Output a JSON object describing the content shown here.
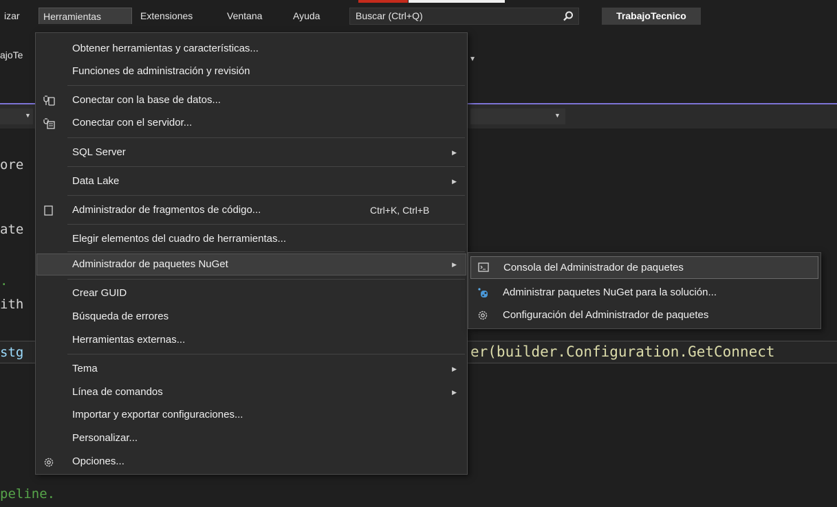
{
  "menubar": {
    "items": [
      {
        "label": "izar",
        "active": false
      },
      {
        "label": "Herramientas",
        "active": true
      },
      {
        "label": "Extensiones",
        "active": false
      },
      {
        "label": "Ventana",
        "active": false
      },
      {
        "label": "Ayuda",
        "active": false
      }
    ],
    "search_placeholder": "Buscar (Ctrl+Q)",
    "search_icon": "search-icon",
    "solution_name": "TrabajoTecnico"
  },
  "toolbar": {
    "fragment": "ajoTe",
    "overflow_glyph": "▾"
  },
  "editor": {
    "lines": [
      {
        "text": "ore"
      },
      {
        "text": "ate"
      },
      {
        "text": "."
      },
      {
        "text": "ith"
      },
      {
        "text": "stg"
      },
      {
        "text": "er(builder.Configuration.GetConnect"
      },
      {
        "text": "peline."
      }
    ]
  },
  "tools_menu": {
    "items": [
      {
        "label": "Obtener herramientas y características...",
        "icon": ""
      },
      {
        "label": "Funciones de administración y revisión",
        "icon": ""
      },
      {
        "label": "Conectar con la base de datos...",
        "icon": "database-connect-icon"
      },
      {
        "label": "Conectar con el servidor...",
        "icon": "server-connect-icon"
      },
      {
        "label": "SQL Server",
        "submenu": true
      },
      {
        "label": "Data Lake",
        "submenu": true
      },
      {
        "label": "Administrador de fragmentos de código...",
        "shortcut": "Ctrl+K, Ctrl+B",
        "icon": "snippet-icon"
      },
      {
        "label": "Elegir elementos del cuadro de herramientas..."
      },
      {
        "label": "Administrador de paquetes NuGet",
        "submenu": true,
        "highlighted": true
      },
      {
        "label": "Crear GUID"
      },
      {
        "label": "Búsqueda de errores"
      },
      {
        "label": "Herramientas externas..."
      },
      {
        "label": "Tema",
        "submenu": true
      },
      {
        "label": "Línea de comandos",
        "submenu": true
      },
      {
        "label": "Importar y exportar configuraciones..."
      },
      {
        "label": "Personalizar..."
      },
      {
        "label": "Opciones...",
        "icon": "gear-icon"
      }
    ]
  },
  "nuget_submenu": {
    "items": [
      {
        "label": "Consola del Administrador de paquetes",
        "icon": "console-icon",
        "highlighted": true
      },
      {
        "label": "Administrar paquetes NuGet para la solución...",
        "icon": "nuget-icon"
      },
      {
        "label": "Configuración del Administrador de paquetes",
        "icon": "gear-icon"
      }
    ]
  },
  "colors": {
    "background": "#1f1f1f",
    "menu_bg": "#2b2b2b",
    "accent_purple": "#7d74d6",
    "accent_red": "#c42b1c",
    "code_green": "#57a64a",
    "code_teal": "#4ec9b0",
    "code_blue": "#9cdcfe",
    "code_yellow": "#dcdcaa"
  }
}
